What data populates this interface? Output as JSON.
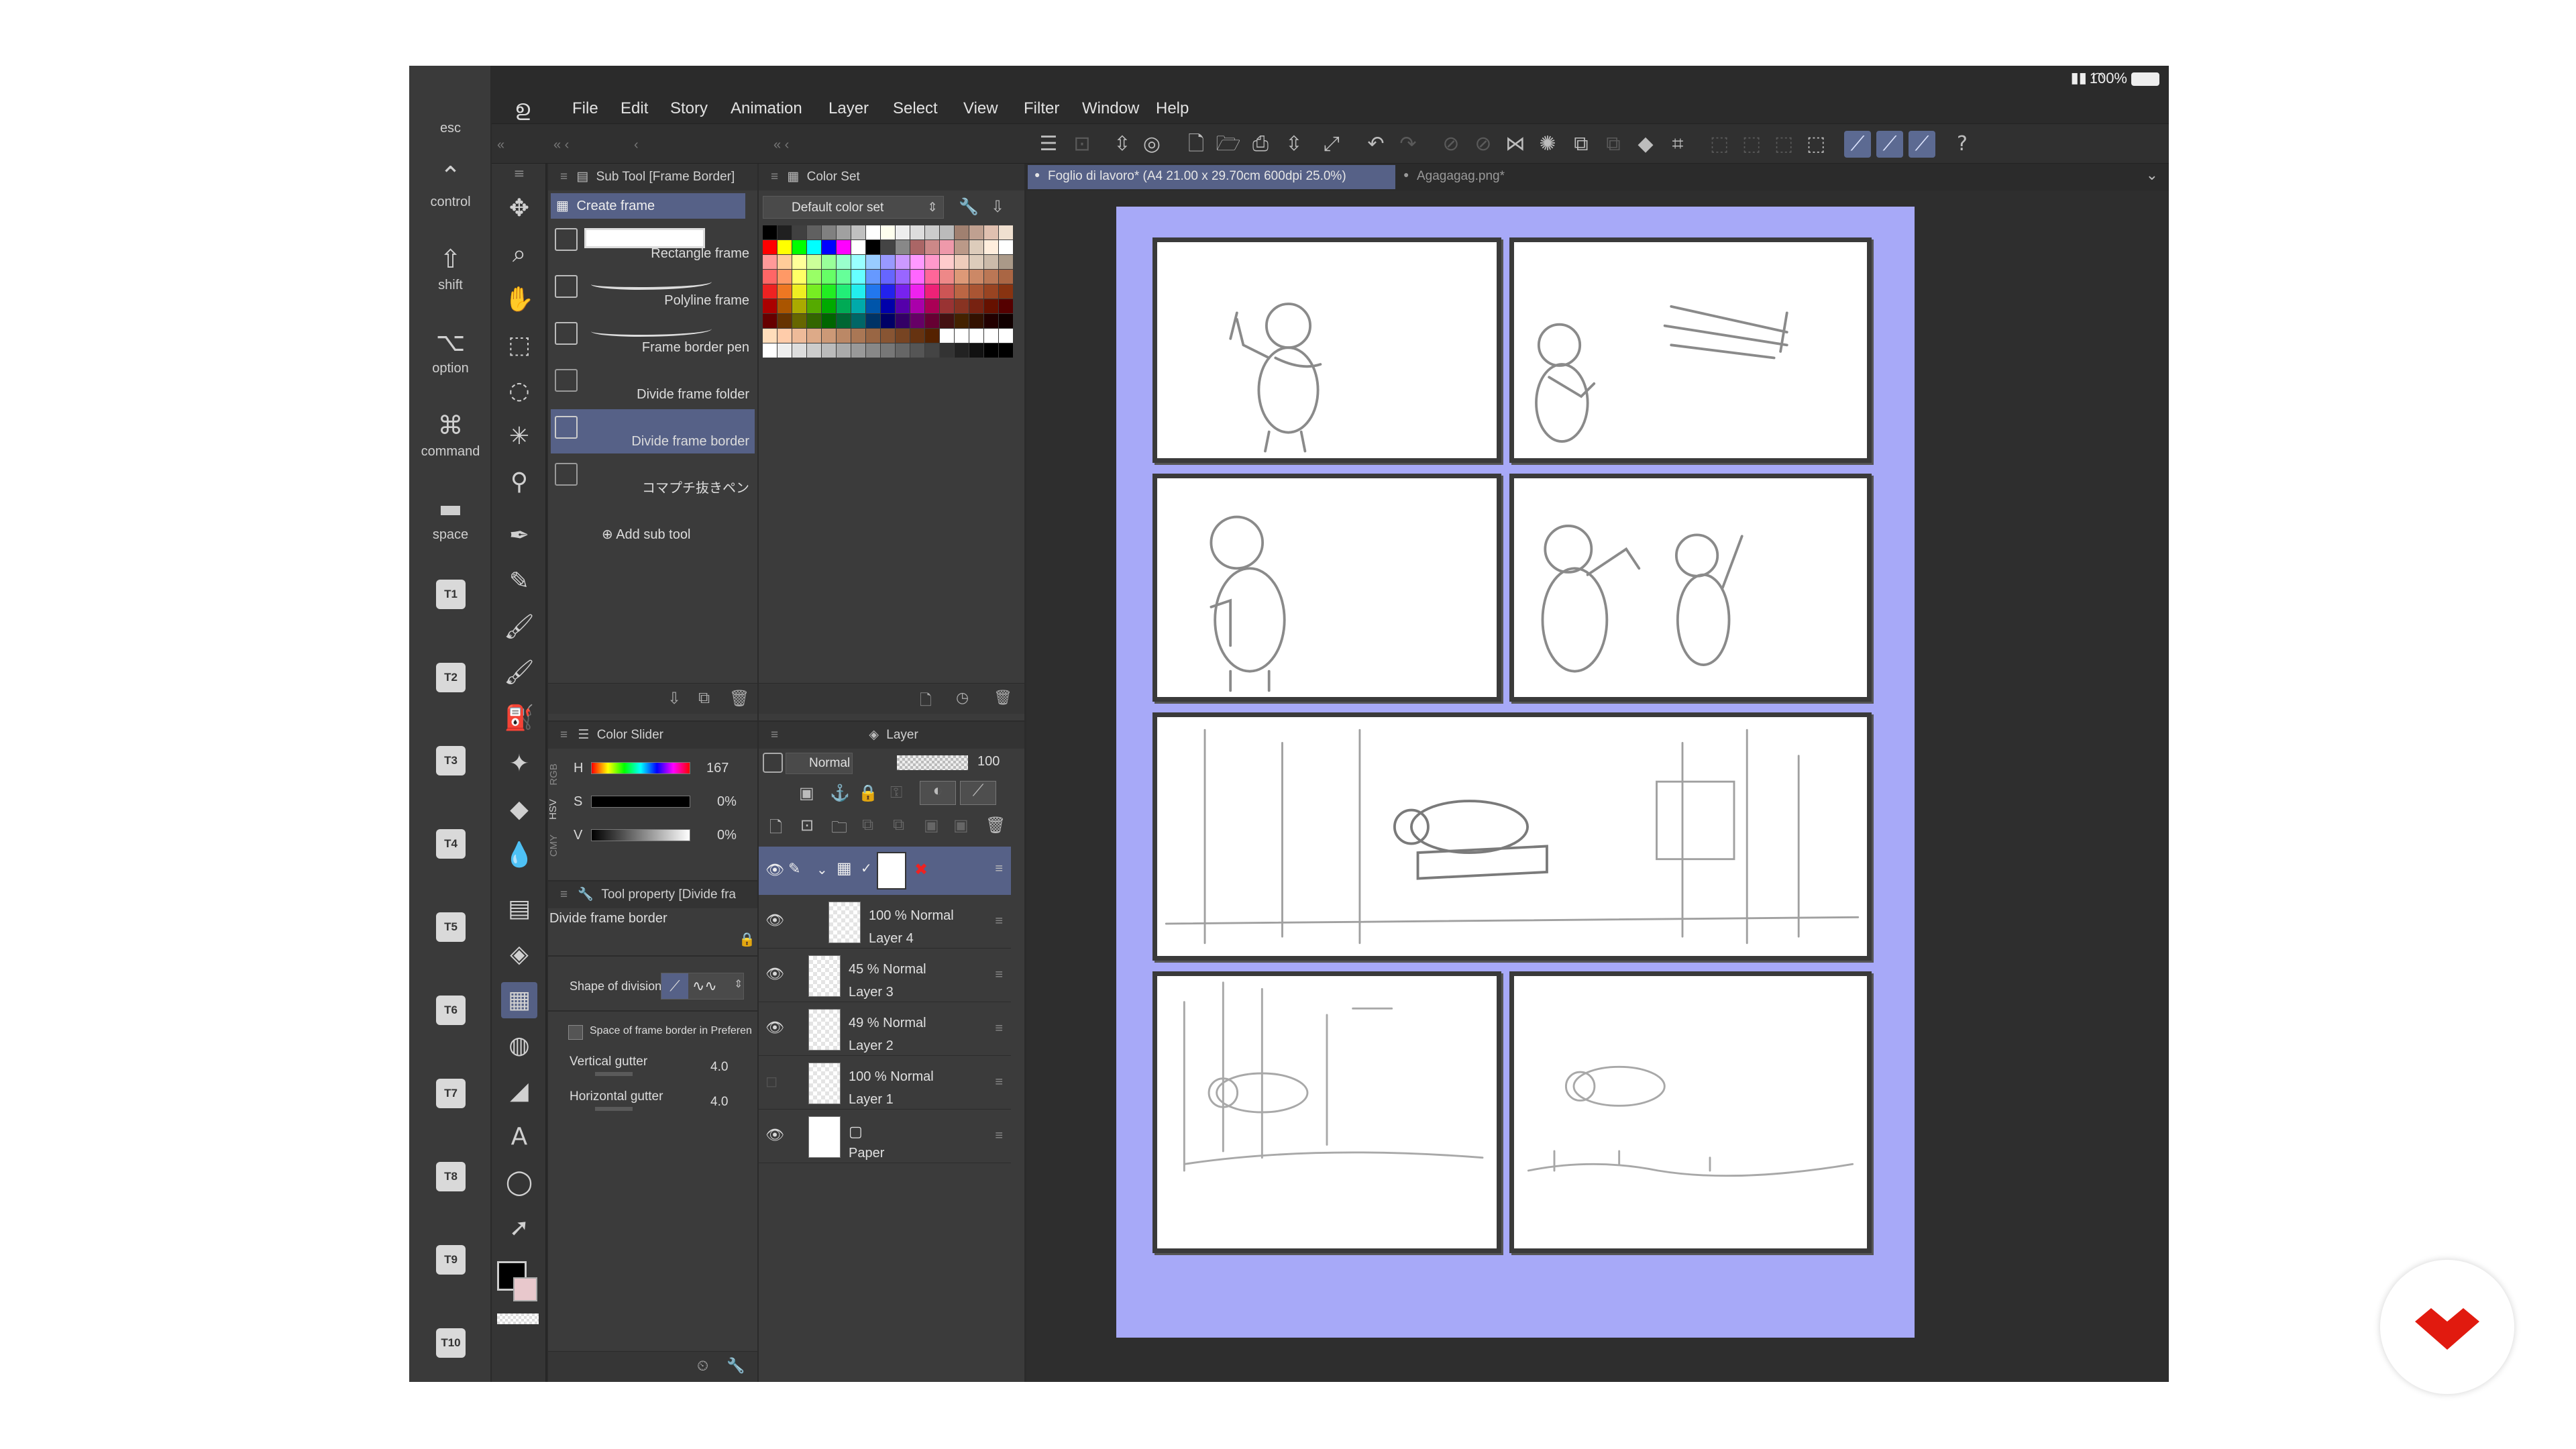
{
  "status": {
    "battery": "100%"
  },
  "modifiers": [
    {
      "label": "esc",
      "glyph": ""
    },
    {
      "label": "control",
      "glyph": "⌃"
    },
    {
      "label": "shift",
      "glyph": "⇧"
    },
    {
      "label": "option",
      "glyph": "⌥"
    },
    {
      "label": "command",
      "glyph": "⌘"
    },
    {
      "label": "space",
      "glyph": "▬"
    }
  ],
  "tbuttons": [
    "T1",
    "T2",
    "T3",
    "T4",
    "T5",
    "T6",
    "T7",
    "T8",
    "T9",
    "T10"
  ],
  "menu": [
    "File",
    "Edit",
    "Story",
    "Animation",
    "Layer",
    "Select",
    "View",
    "Filter",
    "Window",
    "Help"
  ],
  "subtool": {
    "tab_title": "Sub Tool [Frame Border]",
    "group": "Create frame",
    "items": [
      "Rectangle frame",
      "Polyline frame",
      "Frame border pen",
      "Divide frame folder",
      "Divide frame border",
      "コマプチ抜きペン"
    ],
    "add_label": "Add sub tool"
  },
  "colorset": {
    "tab_title": "Color Set",
    "selected_set": "Default color set"
  },
  "colorslider": {
    "tab_title": "Color Slider",
    "side_tabs": [
      "RGB",
      "HSV",
      "CMY"
    ],
    "rows": [
      {
        "label": "H",
        "value": "167"
      },
      {
        "label": "S",
        "value": "0%"
      },
      {
        "label": "V",
        "value": "0%"
      }
    ]
  },
  "toolprop": {
    "tab_title": "Tool property [Divide fra",
    "tool_name": "Divide frame border",
    "shape_label": "Shape of division",
    "space_label": "Space of frame border in Preferen",
    "vgutter_label": "Vertical gutter",
    "vgutter_value": "4.0",
    "hgutter_label": "Horizontal gutter",
    "hgutter_value": "4.0"
  },
  "layer": {
    "tab_title": "Layer",
    "blend_mode": "Normal",
    "opacity": "100",
    "rows": [
      {
        "mode": "100 % Normal",
        "name": "Layer 4"
      },
      {
        "mode": "45 % Normal",
        "name": "Layer 3"
      },
      {
        "mode": "49 % Normal",
        "name": "Layer 2"
      },
      {
        "mode": "100 % Normal",
        "name": "Layer 1"
      },
      {
        "mode": "",
        "name": "Paper"
      }
    ]
  },
  "documents": {
    "active": "Foglio di lavoro* (A4 21.00 x 29.70cm 600dpi 25.0%)",
    "other": "Agagagag.png*"
  },
  "colors": {
    "accent": "#566187",
    "page_bg": "#a7a9f8",
    "panel": "#3b3b3b",
    "logo_red": "#e11a0f"
  }
}
